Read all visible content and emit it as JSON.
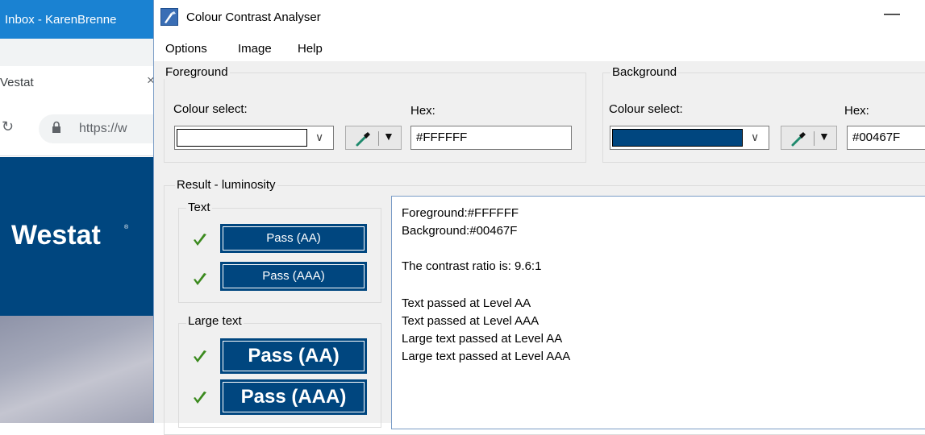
{
  "browser": {
    "window_title": "Inbox - KarenBrenne",
    "tab_label": "Vestat",
    "tab_close": "×",
    "back": "↻",
    "url": "https://w",
    "logo": "Westat",
    "logo_mark": "®",
    "colors": {
      "titlebar": "#1a82d2",
      "hero": "#00467f"
    }
  },
  "app": {
    "title": "Colour Contrast Analyser",
    "minimize": "—",
    "menu": [
      "Options",
      "Image",
      "Help"
    ]
  },
  "foreground": {
    "group_label": "Foreground",
    "colour_select_label": "Colour select:",
    "hex_label": "Hex:",
    "hex_value": "#FFFFFF",
    "swatch_color": "#FFFFFF"
  },
  "background": {
    "group_label": "Background",
    "colour_select_label": "Colour select:",
    "hex_label": "Hex:",
    "hex_value": "#00467F",
    "swatch_color": "#00467F"
  },
  "result": {
    "group_label": "Result - luminosity",
    "text_group_label": "Text",
    "large_text_group_label": "Large text",
    "text_pass_aa": "Pass (AA)",
    "text_pass_aaa": "Pass (AAA)",
    "large_pass_aa": "Pass (AA)",
    "large_pass_aaa": "Pass (AAA)",
    "lines": [
      "Foreground:#FFFFFF",
      "Background:#00467F",
      "The contrast ratio is: 9.6:1",
      "Text passed at Level AA",
      "Text passed at Level AAA",
      "Large text passed at Level AA",
      "Large text passed at Level AAA"
    ]
  },
  "icons": {
    "app": "contrast-analyser-icon",
    "picker": "eyedropper-icon",
    "check": "green-checkmark-icon",
    "dropdown": "chevron-down-icon"
  }
}
